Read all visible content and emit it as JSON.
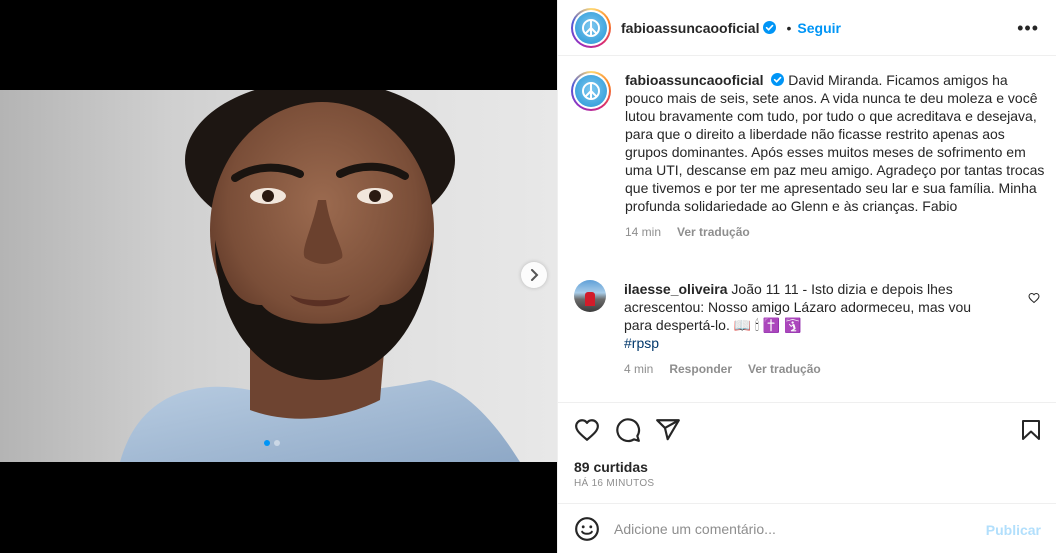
{
  "post": {
    "username": "fabioassuncaooficial",
    "bullet": "•",
    "follow_label": "Seguir",
    "more_label": "•••"
  },
  "caption": {
    "text": "David Miranda. Ficamos amigos ha pouco mais de seis, sete anos. A vida nunca te deu moleza e você lutou bravamente com tudo, por tudo o que acreditava e desejava, para que o direito a liberdade não ficasse restrito apenas aos grupos dominantes. Após esses muitos meses de sofrimento em uma UTI, descanse em paz meu amigo. Agradeço por tantas trocas que tivemos e por ter me apresentado seu lar e sua família. Minha profunda solidariedade ao Glenn e às crianças. Fabio",
    "time": "14 min",
    "translate_label": "Ver tradução"
  },
  "comment": {
    "username": "ilaesse_oliveira",
    "text": "João 11\n11 - Isto dizia e depois lhes acrescentou: Nosso amigo Lázaro adormeceu, mas vou para despertá-lo. 📖🕯✝️🛐",
    "text_main": "João 11 11 - Isto dizia e depois lhes acrescentou: Nosso amigo Lázaro adormeceu, mas vou para despertá-lo. 📖 🕯 ✝️ 🛐",
    "hashtag": "#rpsp",
    "time": "4 min",
    "reply_label": "Responder",
    "translate_label": "Ver tradução"
  },
  "stats": {
    "likes": "89 curtidas",
    "timestamp": "HÁ 16 MINUTOS"
  },
  "composer": {
    "placeholder": "Adicione um comentário...",
    "publish_label": "Publicar"
  },
  "carousel": {
    "slide_count": 2,
    "active_index": 0
  },
  "colors": {
    "accent": "#0095f6",
    "text": "#262626",
    "muted": "#8e8e8e",
    "publish_disabled": "#b2dffc",
    "hashtag": "#00376b"
  },
  "icons": {
    "more": "more-options-icon",
    "verified": "verified-badge-icon",
    "heart": "heart-icon",
    "comment": "comment-icon",
    "share": "share-icon",
    "save": "bookmark-icon",
    "emoji": "emoji-icon",
    "next": "chevron-right-icon"
  }
}
